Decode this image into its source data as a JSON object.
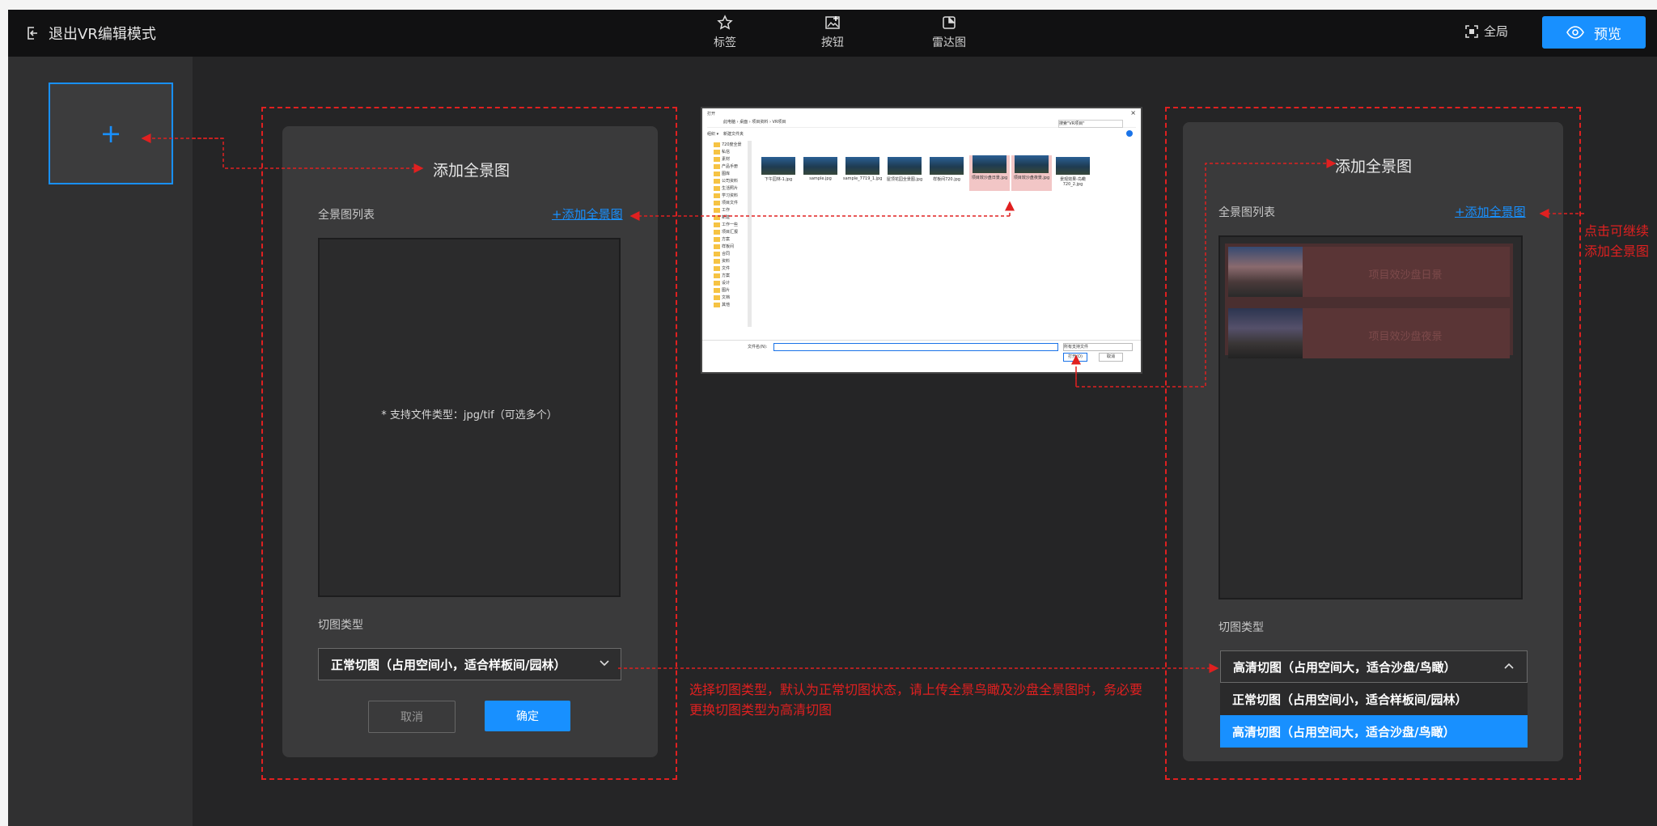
{
  "toolbar": {
    "exit_label": "退出VR编辑模式",
    "tools": [
      {
        "label": "标签",
        "icon": "tag-icon"
      },
      {
        "label": "按钮",
        "icon": "button-image-icon"
      },
      {
        "label": "雷达图",
        "icon": "radar-icon"
      }
    ],
    "fullscreen_label": "全局",
    "preview_label": "预览"
  },
  "add_scene": {
    "label": "+"
  },
  "left_panel": {
    "title": "添加全景图",
    "list_label": "全景图列表",
    "add_link": "+添加全景图",
    "hint": "* 支持文件类型：jpg/tif（可选多个）",
    "cut_label": "切图类型",
    "cut_value": "正常切图（占用空间小，适合样板间/园林）",
    "cancel": "取消",
    "confirm": "确定"
  },
  "right_panel": {
    "title": "添加全景图",
    "list_label": "全景图列表",
    "add_link": "+添加全景图",
    "items": [
      {
        "name": "项目效沙盘日景"
      },
      {
        "name": "项目效沙盘夜景"
      }
    ],
    "cut_label": "切图类型",
    "cut_value": "高清切图（占用空间大，适合沙盘/鸟瞰）",
    "options": [
      "正常切图（占用空间小，适合样板间/园林）",
      "高清切图（占用空间大，适合沙盘/鸟瞰）"
    ]
  },
  "annotations": {
    "middle": "选择切图类型，默认为正常切图状态，请上传全景鸟瞰及沙盘全景图时，务必要更换切图类型为高清切图",
    "right_line1": "点击可继续",
    "right_line2": "添加全景图"
  },
  "file_dialog": {
    "title": "打开",
    "path": "此电脑 › 桌面 › 项目资料 › VR项目",
    "search_placeholder": "搜索\"VR项目\"",
    "organize": "组织 ▾",
    "new_folder": "新建文件夹",
    "folders": [
      "720度全景",
      "私信",
      "素材",
      "产品手册",
      "图库",
      "公司资料",
      "生活照片",
      "学习资料",
      "项目文件",
      "工作",
      "新建",
      "工作一些",
      "项目汇报",
      "方案",
      "样板间",
      "合同",
      "资料",
      "文件",
      "方案",
      "设计",
      "图片",
      "文档",
      "其他"
    ],
    "files": [
      "下午园林-1.jpg",
      "sample.jpg",
      "sample_7719_1.jpg",
      "屋顶花园全景图.jpg",
      "样板间720.jpg",
      "项目效沙盘日景.jpg",
      "项目效沙盘夜景.jpg",
      "景观效果-鸟瞰720_2.jpg"
    ],
    "filename_label": "文件名(N):",
    "filetype": "所有支持文件",
    "open_btn": "打开(O)",
    "cancel_btn": "取消"
  },
  "colors": {
    "accent": "#1890ff",
    "annotation": "#e02020",
    "panel": "#3a3a3b",
    "background": "#252526"
  }
}
